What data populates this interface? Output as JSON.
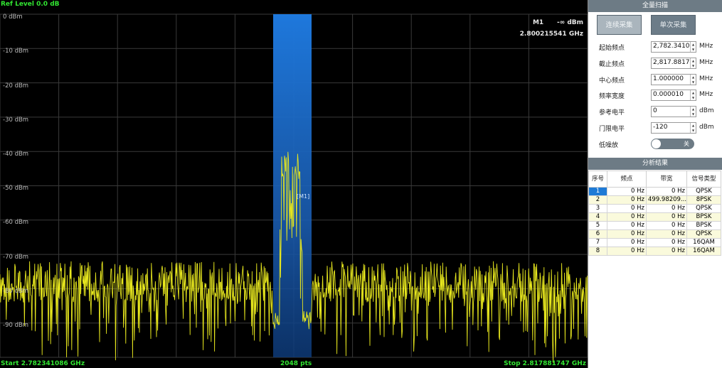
{
  "spectrum": {
    "ref_level": "Ref Level    0.0 dB",
    "y_labels": [
      "0 dBm",
      "-10 dBm",
      "-20 dBm",
      "-30 dBm",
      "-40 dBm",
      "-50 dBm",
      "-60 dBm",
      "-70 dBm",
      "-80 dBm",
      "-90 dBm"
    ],
    "marker": {
      "name": "M1",
      "level": "-∞ dBm",
      "frequency": "2.800215541 GHz",
      "tag": "[M1]"
    },
    "start_label": "Start 2.782341086 GHz",
    "points_label": "2048 pts",
    "stop_label": "Stop 2.817881747 GHz",
    "trace_color": "#e6e61e",
    "highlight_color": "#1e78dc"
  },
  "panel": {
    "scan_header": "全量扫描",
    "btn_continuous": "连续采集",
    "btn_single": "单次采集",
    "fields": [
      {
        "label": "起始频点",
        "value": "2,782.341086",
        "unit": "MHz"
      },
      {
        "label": "截止频点",
        "value": "2,817.881747",
        "unit": "MHz"
      },
      {
        "label": "中心频点",
        "value": "1.000000",
        "unit": "MHz"
      },
      {
        "label": "频率宽度",
        "value": "0.000010",
        "unit": "MHz"
      },
      {
        "label": "参考电平",
        "value": "0",
        "unit": "dBm"
      },
      {
        "label": "门限电平",
        "value": "-120",
        "unit": "dBm"
      }
    ],
    "low_noise_label": "低噪放",
    "low_noise_state": "关",
    "results_header": "分析结果",
    "table_headers": [
      "序号",
      "频点",
      "带宽",
      "信号类型"
    ],
    "rows": [
      [
        "1",
        "0 Hz",
        "0 Hz",
        "QPSK"
      ],
      [
        "2",
        "0 Hz",
        "499.98209...",
        "8PSK"
      ],
      [
        "3",
        "0 Hz",
        "0 Hz",
        "QPSK"
      ],
      [
        "4",
        "0 Hz",
        "0 Hz",
        "BPSK"
      ],
      [
        "5",
        "0 Hz",
        "0 Hz",
        "BPSK"
      ],
      [
        "6",
        "0 Hz",
        "0 Hz",
        "QPSK"
      ],
      [
        "7",
        "0 Hz",
        "0 Hz",
        "16QAM"
      ],
      [
        "8",
        "0 Hz",
        "0 Hz",
        "16QAM"
      ]
    ]
  }
}
